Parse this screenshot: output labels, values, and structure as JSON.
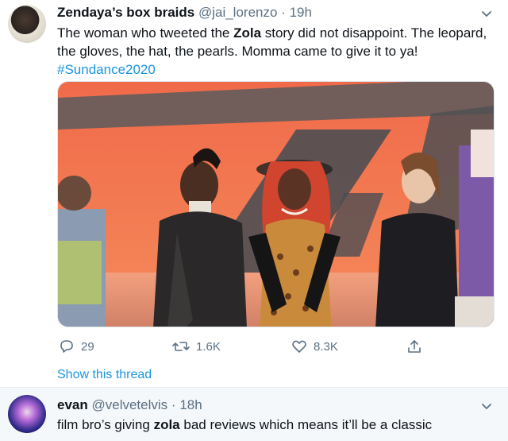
{
  "tweet1": {
    "display_name": "Zendaya’s box braids",
    "handle": "@jai_lorenzo",
    "separator": "·",
    "time": "19h",
    "text_line1_prefix": "The woman who tweeted the ",
    "text_bold": "Zola",
    "text_line1_suffix": " story did not disappoint. The leopard,",
    "text_line2": "the gloves, the hat, the pearls. Momma came to give it to ya!",
    "hashtag": "#Sundance2020",
    "reply_count": "29",
    "retweet_count": "1.6K",
    "like_count": "8.3K",
    "show_thread": "Show this thread"
  },
  "tweet2": {
    "display_name": "evan",
    "handle": "@velvetelvis",
    "separator": "·",
    "time": "18h",
    "text_prefix": "film bro’s giving ",
    "text_bold": "zola",
    "text_suffix": " bad reviews which means it’ll be a classic"
  },
  "colors": {
    "accent": "#1b95e0",
    "secondary_text": "#5b7083",
    "divider": "#e6ecf0"
  },
  "icons": {
    "reply": "reply-icon",
    "retweet": "retweet-icon",
    "like": "heart-icon",
    "share": "share-icon",
    "more": "chevron-down-icon"
  }
}
